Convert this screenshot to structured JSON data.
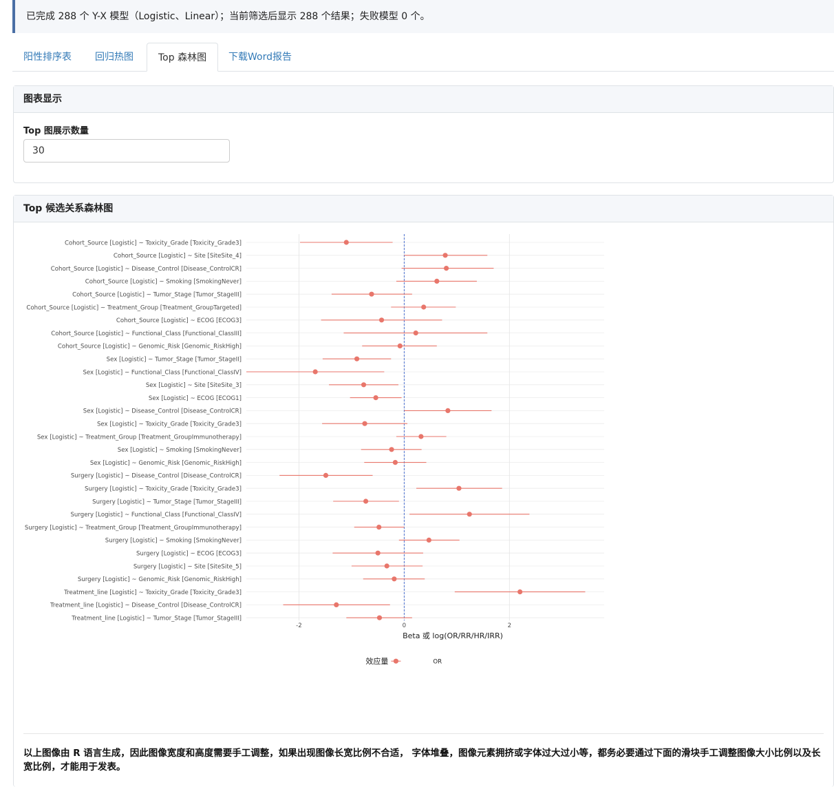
{
  "status_message": "已完成 288 个 Y-X 模型（Logistic、Linear）；当前筛选后显示 288 个结果；失败模型 0 个。",
  "tabs": [
    {
      "label": "阳性排序表",
      "active": false
    },
    {
      "label": "回归热图",
      "active": false
    },
    {
      "label": "Top 森林图",
      "active": true
    },
    {
      "label": "下载Word报告",
      "active": false
    }
  ],
  "settings_card": {
    "title": "图表显示",
    "top_n_label": "Top 图展示数量",
    "top_n_value": "30"
  },
  "forest_card": {
    "title": "Top 候选关系森林图",
    "note": "以上图像由 R 语言生成，因此图像宽度和高度需要手工调整，如果出现图像长宽比例不合适， 字体堆叠，图像元素拥挤或字体过大过小等，都务必要通过下面的滑块手工调整图像大小比例以及长宽比例，才能用于发表。"
  },
  "chart_data": {
    "type": "forest",
    "title": "",
    "xlabel": "Beta 或 log(OR/RR/HR/IRR)",
    "ylabel": "",
    "xlim": [
      -3.0,
      3.8
    ],
    "x_ticks": [
      -2,
      0,
      2
    ],
    "reference_line": 0,
    "legend": {
      "title": "效应量",
      "entries": [
        "OR"
      ],
      "position": "bottom"
    },
    "color": "#e8766b",
    "rows": [
      {
        "label": "Cohort_Source [Logistic] ~ Toxicity_Grade [Toxicity_Grade3]",
        "est": -1.1,
        "lo": -1.98,
        "hi": -0.22
      },
      {
        "label": "Cohort_Source [Logistic] ~ Site [SiteSite_4]",
        "est": 0.78,
        "lo": 0.0,
        "hi": 1.58
      },
      {
        "label": "Cohort_Source [Logistic] ~ Disease_Control [Disease_ControlCR]",
        "est": 0.8,
        "lo": -0.05,
        "hi": 1.7
      },
      {
        "label": "Cohort_Source [Logistic] ~ Smoking [SmokingNever]",
        "est": 0.62,
        "lo": -0.15,
        "hi": 1.38
      },
      {
        "label": "Cohort_Source [Logistic] ~ Tumor_Stage [Tumor_StageIII]",
        "est": -0.62,
        "lo": -1.38,
        "hi": 0.15
      },
      {
        "label": "Cohort_Source [Logistic] ~ Treatment_Group [Treatment_GroupTargeted]",
        "est": 0.37,
        "lo": -0.25,
        "hi": 0.98
      },
      {
        "label": "Cohort_Source [Logistic] ~ ECOG [ECOG3]",
        "est": -0.43,
        "lo": -1.58,
        "hi": 0.72
      },
      {
        "label": "Cohort_Source [Logistic] ~ Functional_Class [Functional_ClassIII]",
        "est": 0.22,
        "lo": -1.15,
        "hi": 1.58
      },
      {
        "label": "Cohort_Source [Logistic] ~ Genomic_Risk [Genomic_RiskHigh]",
        "est": -0.08,
        "lo": -0.8,
        "hi": 0.62
      },
      {
        "label": "Sex [Logistic] ~ Tumor_Stage [Tumor_StageII]",
        "est": -0.9,
        "lo": -1.55,
        "hi": -0.25
      },
      {
        "label": "Sex [Logistic] ~ Functional_Class [Functional_ClassIV]",
        "est": -1.69,
        "lo": -3.0,
        "hi": -0.38
      },
      {
        "label": "Sex [Logistic] ~ Site [SiteSite_3]",
        "est": -0.77,
        "lo": -1.43,
        "hi": -0.11
      },
      {
        "label": "Sex [Logistic] ~ ECOG [ECOG1]",
        "est": -0.54,
        "lo": -1.03,
        "hi": -0.05
      },
      {
        "label": "Sex [Logistic] ~ Disease_Control [Disease_ControlCR]",
        "est": 0.83,
        "lo": 0.0,
        "hi": 1.66
      },
      {
        "label": "Sex [Logistic] ~ Toxicity_Grade [Toxicity_Grade3]",
        "est": -0.75,
        "lo": -1.56,
        "hi": 0.06
      },
      {
        "label": "Sex [Logistic] ~ Treatment_Group [Treatment_GroupImmunotherapy]",
        "est": 0.32,
        "lo": -0.15,
        "hi": 0.8
      },
      {
        "label": "Sex [Logistic] ~ Smoking [SmokingNever]",
        "est": -0.24,
        "lo": -0.82,
        "hi": 0.33
      },
      {
        "label": "Sex [Logistic] ~ Genomic_Risk [Genomic_RiskHigh]",
        "est": -0.17,
        "lo": -0.76,
        "hi": 0.42
      },
      {
        "label": "Surgery [Logistic] ~ Disease_Control [Disease_ControlCR]",
        "est": -1.49,
        "lo": -2.37,
        "hi": -0.6
      },
      {
        "label": "Surgery [Logistic] ~ Toxicity_Grade [Toxicity_Grade3]",
        "est": 1.04,
        "lo": 0.23,
        "hi": 1.86
      },
      {
        "label": "Surgery [Logistic] ~ Tumor_Stage [Tumor_StageIII]",
        "est": -0.73,
        "lo": -1.35,
        "hi": -0.1
      },
      {
        "label": "Surgery [Logistic] ~ Functional_Class [Functional_ClassIV]",
        "est": 1.24,
        "lo": 0.1,
        "hi": 2.38
      },
      {
        "label": "Surgery [Logistic] ~ Treatment_Group [Treatment_GroupImmunotherapy]",
        "est": -0.48,
        "lo": -0.95,
        "hi": 0.0
      },
      {
        "label": "Surgery [Logistic] ~ Smoking [SmokingNever]",
        "est": 0.47,
        "lo": -0.1,
        "hi": 1.05
      },
      {
        "label": "Surgery [Logistic] ~ ECOG [ECOG3]",
        "est": -0.5,
        "lo": -1.36,
        "hi": 0.36
      },
      {
        "label": "Surgery [Logistic] ~ Site [SiteSite_5]",
        "est": -0.33,
        "lo": -1.0,
        "hi": 0.35
      },
      {
        "label": "Surgery [Logistic] ~ Genomic_Risk [Genomic_RiskHigh]",
        "est": -0.19,
        "lo": -0.78,
        "hi": 0.39
      },
      {
        "label": "Treatment_line [Logistic] ~ Toxicity_Grade [Toxicity_Grade3]",
        "est": 2.2,
        "lo": 0.96,
        "hi": 3.44
      },
      {
        "label": "Treatment_line [Logistic] ~ Disease_Control [Disease_ControlCR]",
        "est": -1.29,
        "lo": -2.3,
        "hi": -0.27
      },
      {
        "label": "Treatment_line [Logistic] ~ Tumor_Stage [Tumor_StageIII]",
        "est": -0.47,
        "lo": -1.1,
        "hi": 0.15
      }
    ]
  }
}
